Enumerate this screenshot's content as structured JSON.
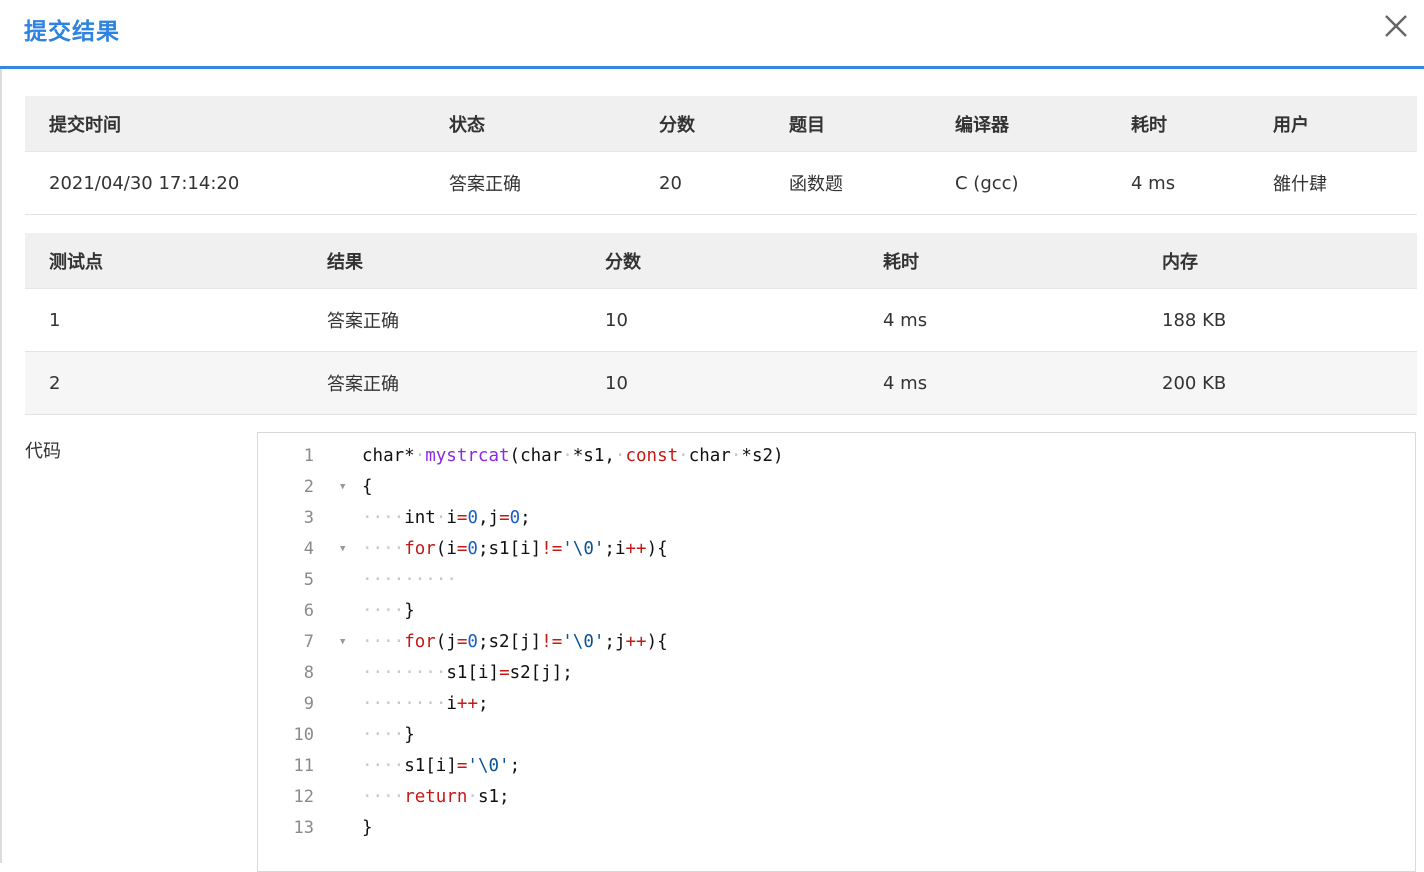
{
  "modal": {
    "title": "提交结果",
    "close_icon": "close-icon"
  },
  "submission": {
    "headers": [
      "提交时间",
      "状态",
      "分数",
      "题目",
      "编译器",
      "耗时",
      "用户"
    ],
    "row": [
      "2021/04/30 17:14:20",
      "答案正确",
      "20",
      "函数题",
      "C (gcc)",
      "4 ms",
      "雒什肆"
    ]
  },
  "testcases": {
    "headers": [
      "测试点",
      "结果",
      "分数",
      "耗时",
      "内存"
    ],
    "rows": [
      [
        "1",
        "答案正确",
        "10",
        "4 ms",
        "188 KB"
      ],
      [
        "2",
        "答案正确",
        "10",
        "4 ms",
        "200 KB"
      ]
    ]
  },
  "code": {
    "label": "代码",
    "line_numbers": [
      "1",
      "2",
      "3",
      "4",
      "5",
      "6",
      "7",
      "8",
      "9",
      "10",
      "11",
      "12",
      "13"
    ],
    "lines": [
      "char* mystrcat(char *s1, const char *s2)",
      "{",
      "    int i=0,j=0;",
      "    for(i=0;s1[i]!='\\0';i++){",
      "         ",
      "    }",
      "    for(j=0;s2[j]!='\\0';j++){",
      "        s1[i]=s2[j];",
      "        i++;",
      "    }",
      "    s1[i]='\\0';",
      "    return s1;",
      "}"
    ],
    "fold_lines": [
      2,
      4,
      7
    ]
  },
  "colors": {
    "accent": "#2d83e0",
    "status_ok": "#e53935"
  }
}
